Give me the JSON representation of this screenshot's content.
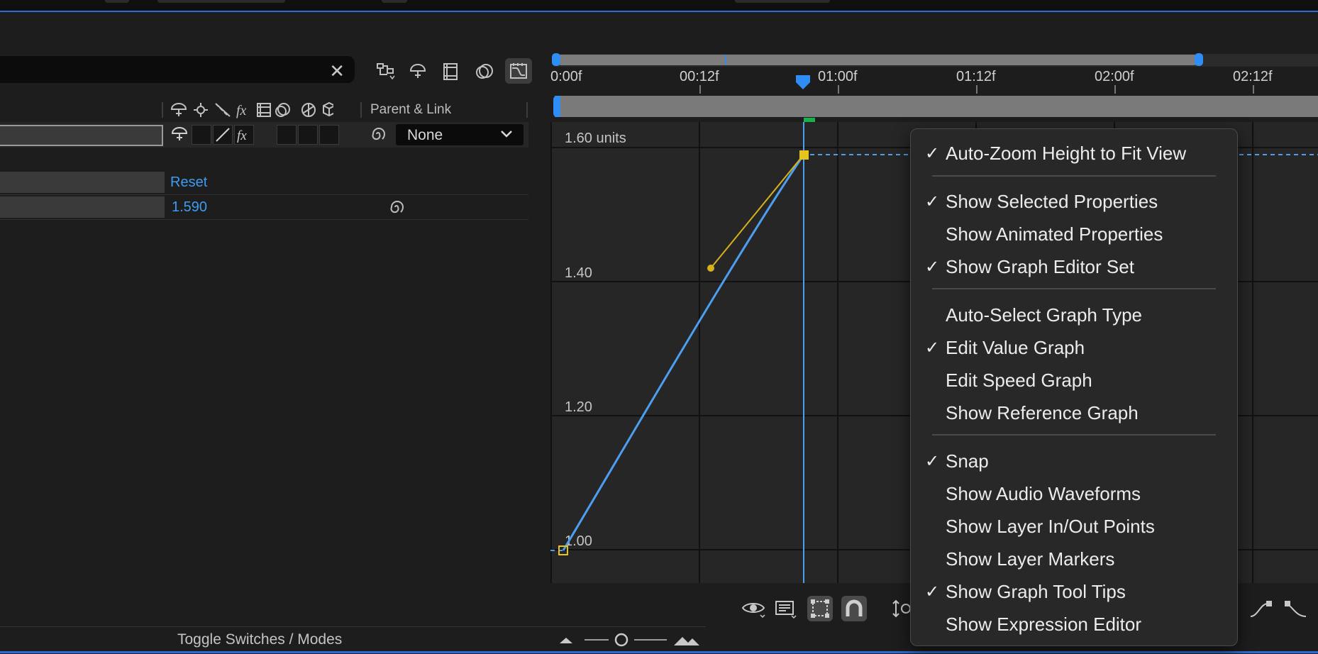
{
  "layers_panel": {
    "search_clear_symbol": "✕",
    "parent_header": "Parent & Link",
    "parent_value": "None",
    "reset_label": "Reset",
    "property_value": "1.590",
    "toggle_label": "Toggle Switches / Modes"
  },
  "timeline": {
    "ticks": [
      "0:00f",
      "00:12f",
      "01:00f",
      "01:12f",
      "02:00f",
      "02:12f"
    ]
  },
  "graph": {
    "y_labels": [
      "1.60 units",
      "1.40",
      "1.20",
      "1.00"
    ],
    "colors": {
      "curve": "#4c9ef0",
      "keyframe": "#e6c419",
      "handle": "#d7b21a",
      "playhead": "#4c9ef0",
      "accent": "#2d6bd8"
    }
  },
  "context_menu": {
    "items": [
      {
        "label": "Auto-Zoom Height to Fit View",
        "checked": true
      },
      {
        "label": "Show Selected Properties",
        "checked": true
      },
      {
        "label": "Show Animated Properties",
        "checked": false
      },
      {
        "label": "Show Graph Editor Set",
        "checked": true
      },
      {
        "label": "Auto-Select Graph Type",
        "checked": false
      },
      {
        "label": "Edit Value Graph",
        "checked": true
      },
      {
        "label": "Edit Speed Graph",
        "checked": false
      },
      {
        "label": "Show Reference Graph",
        "checked": false
      },
      {
        "label": "Snap",
        "checked": true
      },
      {
        "label": "Show Audio Waveforms",
        "checked": false
      },
      {
        "label": "Show Layer In/Out Points",
        "checked": false
      },
      {
        "label": "Show Layer Markers",
        "checked": false
      },
      {
        "label": "Show Graph Tool Tips",
        "checked": true
      },
      {
        "label": "Show Expression Editor",
        "checked": false
      }
    ],
    "check_symbol": "✓"
  }
}
